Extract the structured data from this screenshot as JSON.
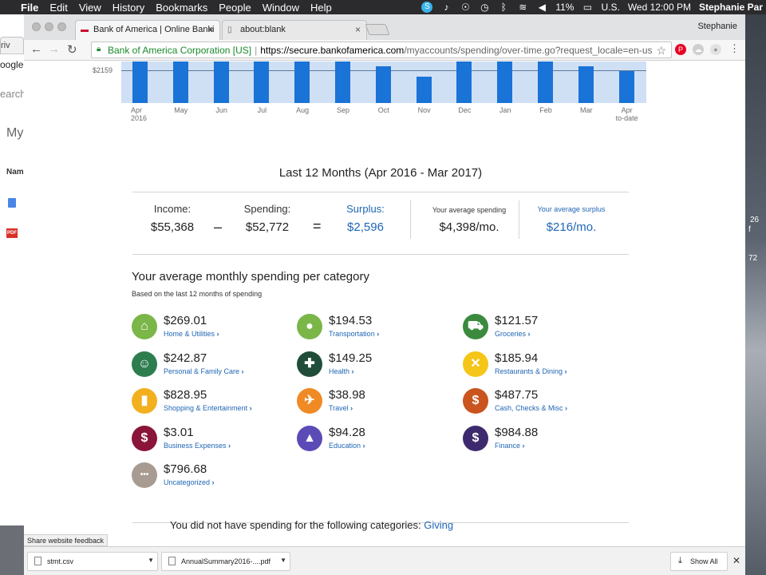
{
  "menubar": {
    "items": [
      "File",
      "Edit",
      "View",
      "History",
      "Bookmarks",
      "People",
      "Window",
      "Help"
    ],
    "battery": "11%",
    "input_source": "U.S.",
    "clock": "Wed 12:00 PM",
    "user": "Stephanie Par"
  },
  "background_left": {
    "tab_text": "riv",
    "google_text": "oogle.",
    "search_text": "earch",
    "my_text": "My",
    "name_text": "Nam"
  },
  "background_right": {
    "line1": "26",
    "line2": "f",
    "line3": "72"
  },
  "browser": {
    "tabs": [
      {
        "title": "Bank of America | Online Banki",
        "active": true
      },
      {
        "title": "about:blank",
        "active": false
      }
    ],
    "profile": "Stephanie",
    "url_org": "Bank of America Corporation [US]",
    "url_scheme_host": "https://secure.bankofamerica.com",
    "url_path": "/myaccounts/spending/over-time.go?request_locale=en-us"
  },
  "chart_data": {
    "type": "bar",
    "reference_label": "$2159",
    "categories": [
      "Apr 2016",
      "May",
      "Jun",
      "Jul",
      "Aug",
      "Sep",
      "Oct",
      "Nov",
      "Dec",
      "Jan",
      "Feb",
      "Mar",
      "Apr to-date"
    ],
    "category_labels": [
      [
        "Apr",
        "2016"
      ],
      [
        "May"
      ],
      [
        "Jun"
      ],
      [
        "Jul"
      ],
      [
        "Aug"
      ],
      [
        "Sep"
      ],
      [
        "Oct"
      ],
      [
        "Nov"
      ],
      [
        "Dec"
      ],
      [
        "Jan"
      ],
      [
        "Feb"
      ],
      [
        "Mar"
      ],
      [
        "Apr",
        "to-date"
      ]
    ],
    "values": [
      6500,
      6500,
      6500,
      6500,
      6500,
      6500,
      5800,
      4100,
      6500,
      6500,
      6500,
      5700,
      5000
    ],
    "reference_value": 2159,
    "ylim": [
      0,
      6500
    ]
  },
  "summary": {
    "title": "Last 12 Months (Apr 2016 - Mar 2017)",
    "income_label": "Income:",
    "income_value": "$55,368",
    "minus": "–",
    "spending_label": "Spending:",
    "spending_value": "$52,772",
    "equals": "=",
    "surplus_label": "Surplus:",
    "surplus_value": "$2,596",
    "avg_spending_label": "Your average spending",
    "avg_spending_value": "$4,398/mo.",
    "avg_surplus_label": "Your average surplus",
    "avg_surplus_value": "$216/mo."
  },
  "categories_section": {
    "heading": "Your average monthly spending per category",
    "subheading": "Based on the last 12 months of spending",
    "items": [
      {
        "amount": "$269.01",
        "name": "Home & Utilities",
        "color": "#7ab648",
        "icon": "home-icon",
        "glyph": "⌂"
      },
      {
        "amount": "$194.53",
        "name": "Transportation",
        "color": "#7ab648",
        "icon": "car-icon",
        "glyph": "●"
      },
      {
        "amount": "$121.57",
        "name": "Groceries",
        "color": "#3b8a3e",
        "icon": "cart-icon",
        "glyph": "⛟"
      },
      {
        "amount": "$242.87",
        "name": "Personal & Family Care",
        "color": "#2e7d4f",
        "icon": "family-icon",
        "glyph": "☺"
      },
      {
        "amount": "$149.25",
        "name": "Health",
        "color": "#1f4d3a",
        "icon": "health-icon",
        "glyph": "✚"
      },
      {
        "amount": "$185.94",
        "name": "Restaurants & Dining",
        "color": "#f5c518",
        "icon": "dining-icon",
        "glyph": "✕"
      },
      {
        "amount": "$828.95",
        "name": "Shopping & Entertainment",
        "color": "#f2b01e",
        "icon": "shopping-bag-icon",
        "glyph": "▮"
      },
      {
        "amount": "$38.98",
        "name": "Travel",
        "color": "#f08a24",
        "icon": "airplane-icon",
        "glyph": "✈"
      },
      {
        "amount": "$487.75",
        "name": "Cash, Checks & Misc",
        "color": "#c9541e",
        "icon": "cash-icon",
        "glyph": "$"
      },
      {
        "amount": "$3.01",
        "name": "Business Expenses",
        "color": "#8a1538",
        "icon": "business-icon",
        "glyph": "$"
      },
      {
        "amount": "$94.28",
        "name": "Education",
        "color": "#5b4bb7",
        "icon": "graduation-cap-icon",
        "glyph": "▲"
      },
      {
        "amount": "$984.88",
        "name": "Finance",
        "color": "#3d2a6e",
        "icon": "finance-icon",
        "glyph": "$"
      },
      {
        "amount": "$796.68",
        "name": "Uncategorized",
        "color": "#a89c92",
        "icon": "ellipsis-icon",
        "glyph": "•••"
      }
    ]
  },
  "no_spending": {
    "text": "You did not have spending for the following categories: ",
    "link": "Giving"
  },
  "status": {
    "feedback": "Share website feedback"
  },
  "downloads": {
    "items": [
      "stmt.csv",
      "AnnualSummary2016-....pdf"
    ],
    "show_all": "Show All"
  }
}
